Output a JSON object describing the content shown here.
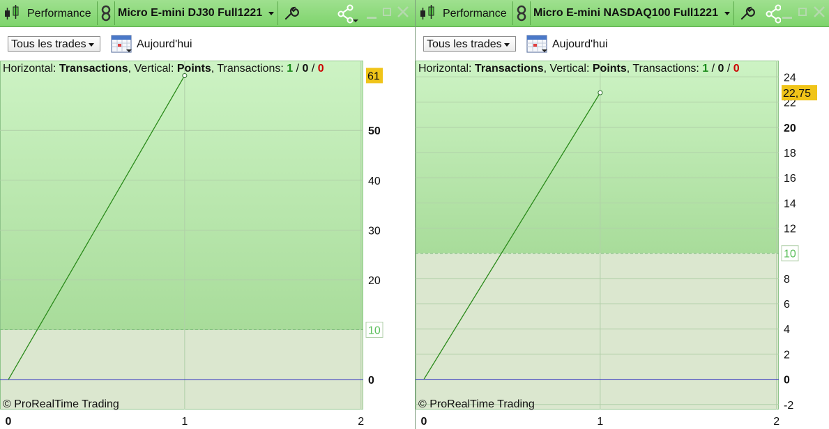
{
  "panels": [
    {
      "id": "left",
      "title": {
        "performance_label": "Performance",
        "instrument": "Micro E-mini DJ30 Full1221"
      },
      "toolbar": {
        "filter_select": "Tous les trades",
        "date_label": "Aujourd'hui"
      },
      "chart": {
        "info_prefix": "Horizontal: ",
        "horizontal_value": "Transactions",
        "info_mid": ", Vertical: ",
        "vertical_value": "Points",
        "info_suffix": ", Transactions: ",
        "count_win": "1",
        "count_neutral": "0",
        "count_loss": "0",
        "slash": " / ",
        "copyright": "© ProRealTime Trading",
        "last_value_tag": "61",
        "threshold_tag": "10"
      }
    },
    {
      "id": "right",
      "title": {
        "performance_label": "Performance",
        "instrument": "Micro E-mini NASDAQ100 Full1221"
      },
      "toolbar": {
        "filter_select": "Tous les trades",
        "date_label": "Aujourd'hui"
      },
      "chart": {
        "info_prefix": "Horizontal: ",
        "horizontal_value": "Transactions",
        "info_mid": ", Vertical: ",
        "vertical_value": "Points",
        "info_suffix": ", Transactions: ",
        "count_win": "1",
        "count_neutral": "0",
        "count_loss": "0",
        "slash": " / ",
        "copyright": "© ProRealTime Trading",
        "last_value_tag": "22,75",
        "threshold_tag": "10"
      }
    }
  ],
  "colors": {
    "win": "#1a8a1a",
    "loss": "#cc0000",
    "line": "#2a8a1a",
    "zero_line": "#3030c0",
    "tag_bg": "#f0c419",
    "threshold_text": "#5bbf5b"
  },
  "chart_data": [
    {
      "type": "line",
      "x": [
        0,
        1
      ],
      "y": [
        0,
        61
      ],
      "xlabel": "Transactions",
      "ylabel": "Points",
      "xlim": [
        0,
        2.1
      ],
      "ylim": [
        -6,
        64
      ],
      "x_ticks": [
        "0",
        "1",
        "2"
      ],
      "y_ticks": [
        "0",
        "10",
        "20",
        "30",
        "40",
        "50"
      ],
      "y_ticks_values": [
        0,
        10,
        20,
        30,
        40,
        50
      ],
      "threshold": 10,
      "grid": true
    },
    {
      "type": "line",
      "x": [
        0,
        1
      ],
      "y": [
        0,
        22.75
      ],
      "xlabel": "Transactions",
      "ylabel": "Points",
      "xlim": [
        0,
        2.1
      ],
      "ylim": [
        -2.4,
        25.3
      ],
      "x_ticks": [
        "0",
        "1",
        "2"
      ],
      "y_ticks": [
        "-2",
        "0",
        "2",
        "4",
        "6",
        "8",
        "12",
        "14",
        "16",
        "18",
        "20",
        "22",
        "24"
      ],
      "y_ticks_values": [
        -2,
        0,
        2,
        4,
        6,
        8,
        12,
        14,
        16,
        18,
        20,
        22,
        24
      ],
      "threshold": 10,
      "grid": true
    }
  ]
}
